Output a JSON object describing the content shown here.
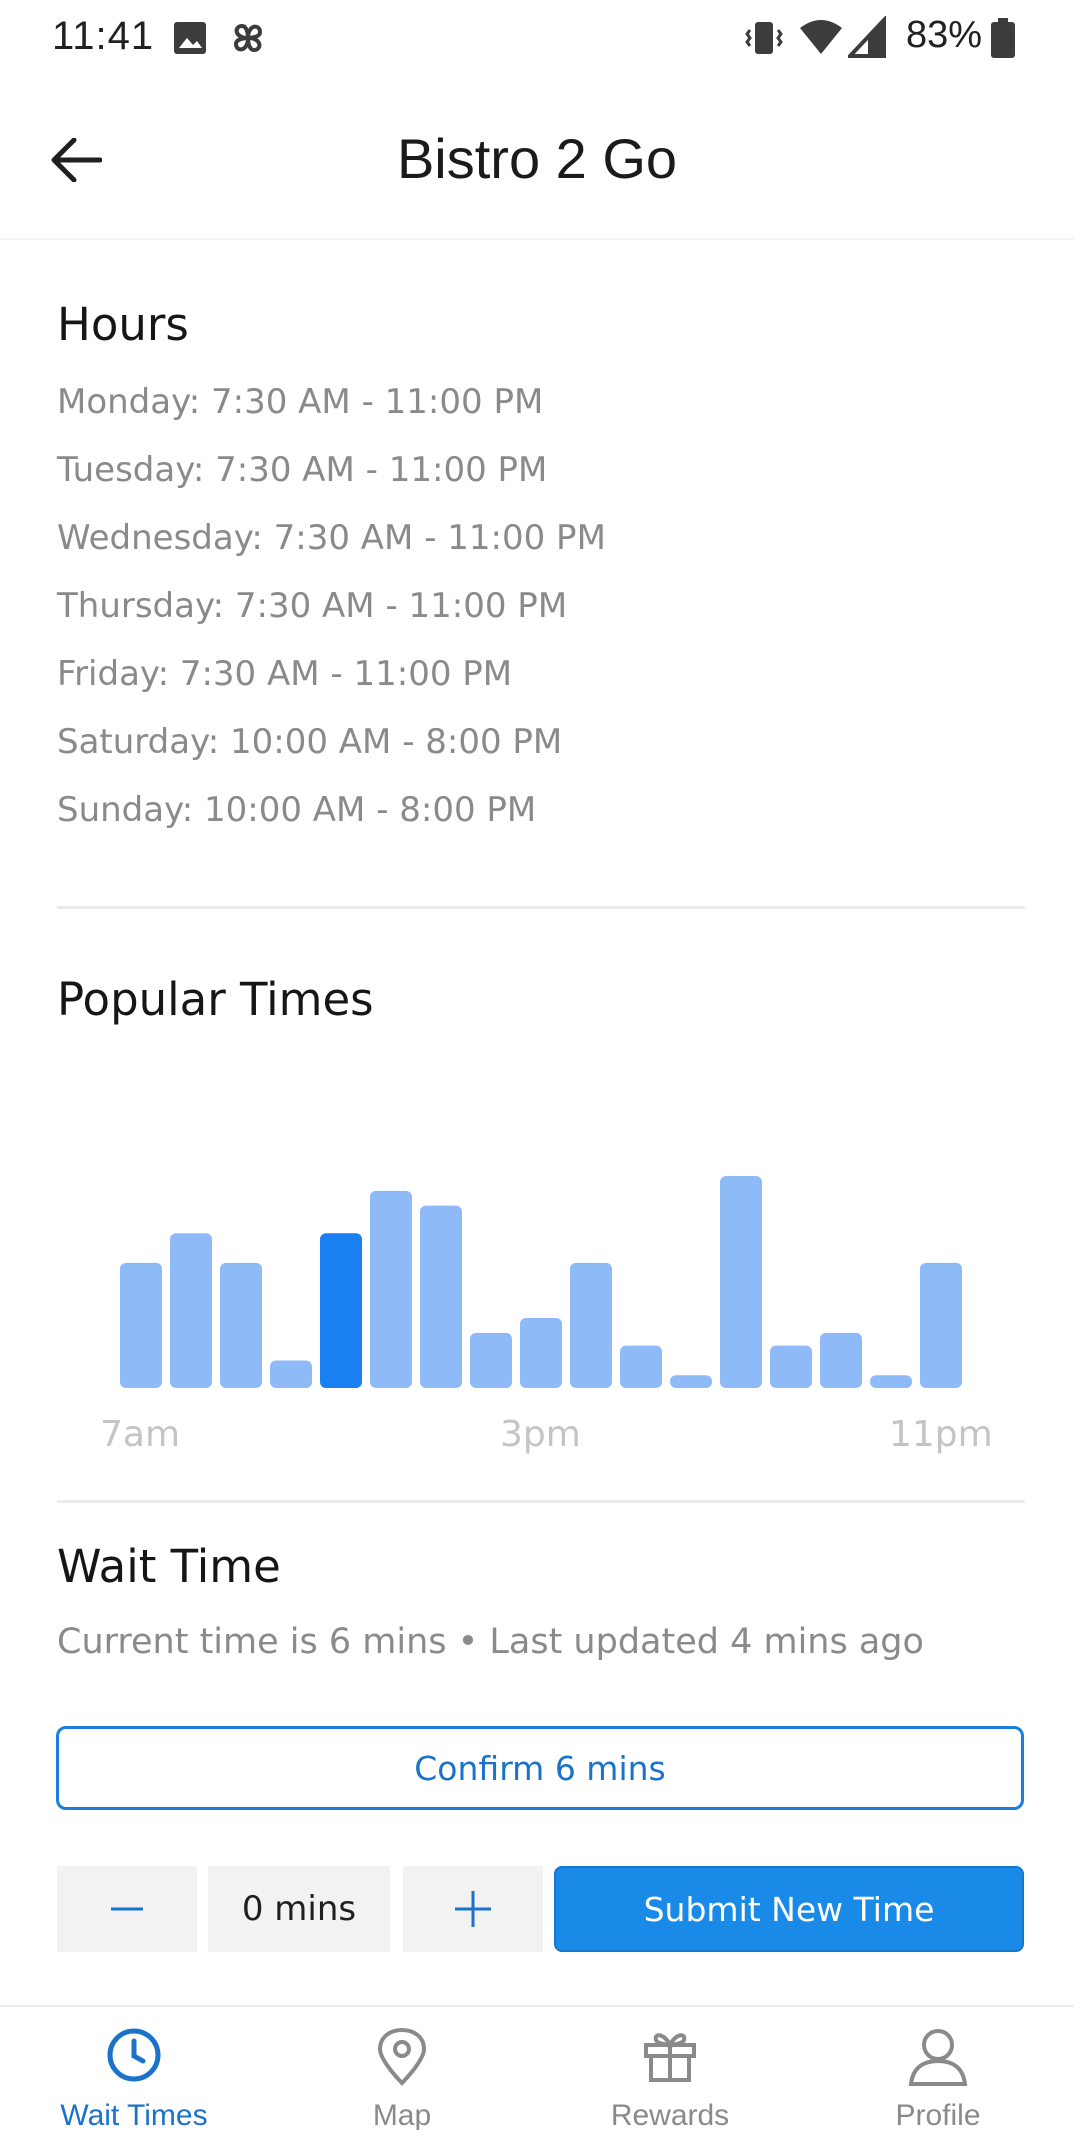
{
  "status_bar": {
    "time": "11:41",
    "battery": "83%"
  },
  "header": {
    "title": "Bistro 2 Go"
  },
  "hours": {
    "title": "Hours",
    "lines": [
      "Monday: 7:30 AM - 11:00 PM",
      "Tuesday: 7:30 AM - 11:00 PM",
      "Wednesday: 7:30 AM - 11:00 PM",
      "Thursday: 7:30 AM - 11:00 PM",
      "Friday: 7:30 AM - 11:00 PM",
      "Saturday: 10:00 AM - 8:00 PM",
      "Sunday: 10:00 AM - 8:00 PM"
    ]
  },
  "popular_times": {
    "title": "Popular Times",
    "axis_labels": [
      "7am",
      "3pm",
      "11pm"
    ]
  },
  "chart_data": {
    "type": "bar",
    "title": "Popular Times",
    "tick_labels": [
      "7am",
      "3pm",
      "11pm"
    ],
    "values": [
      0.59,
      0.73,
      0.59,
      0.13,
      0.73,
      0.93,
      0.86,
      0.26,
      0.33,
      0.59,
      0.2,
      0.06,
      1.0,
      0.2,
      0.26,
      0.06,
      0.59
    ],
    "highlight_index": 4,
    "colors": {
      "bar": "#8ebbf8",
      "highlight": "#1a7ff0"
    },
    "ylim": [
      0,
      1
    ],
    "grid": false
  },
  "wait_time": {
    "title": "Wait Time",
    "subtitle": "Current time is 6 mins • Last updated 4 mins ago",
    "confirm_label": "Confirm 6 mins",
    "stepper_value": "0 mins",
    "submit_label": "Submit New Time"
  },
  "bottom_nav": {
    "items": [
      {
        "label": "Wait Times",
        "icon": "clock-icon",
        "active": true
      },
      {
        "label": "Map",
        "icon": "map-pin-icon",
        "active": false
      },
      {
        "label": "Rewards",
        "icon": "gift-icon",
        "active": false
      },
      {
        "label": "Profile",
        "icon": "person-icon",
        "active": false
      }
    ]
  },
  "colors": {
    "accent": "#1a8ae8",
    "accent_text": "#1a73c8",
    "muted_text": "#8a8a8a"
  }
}
